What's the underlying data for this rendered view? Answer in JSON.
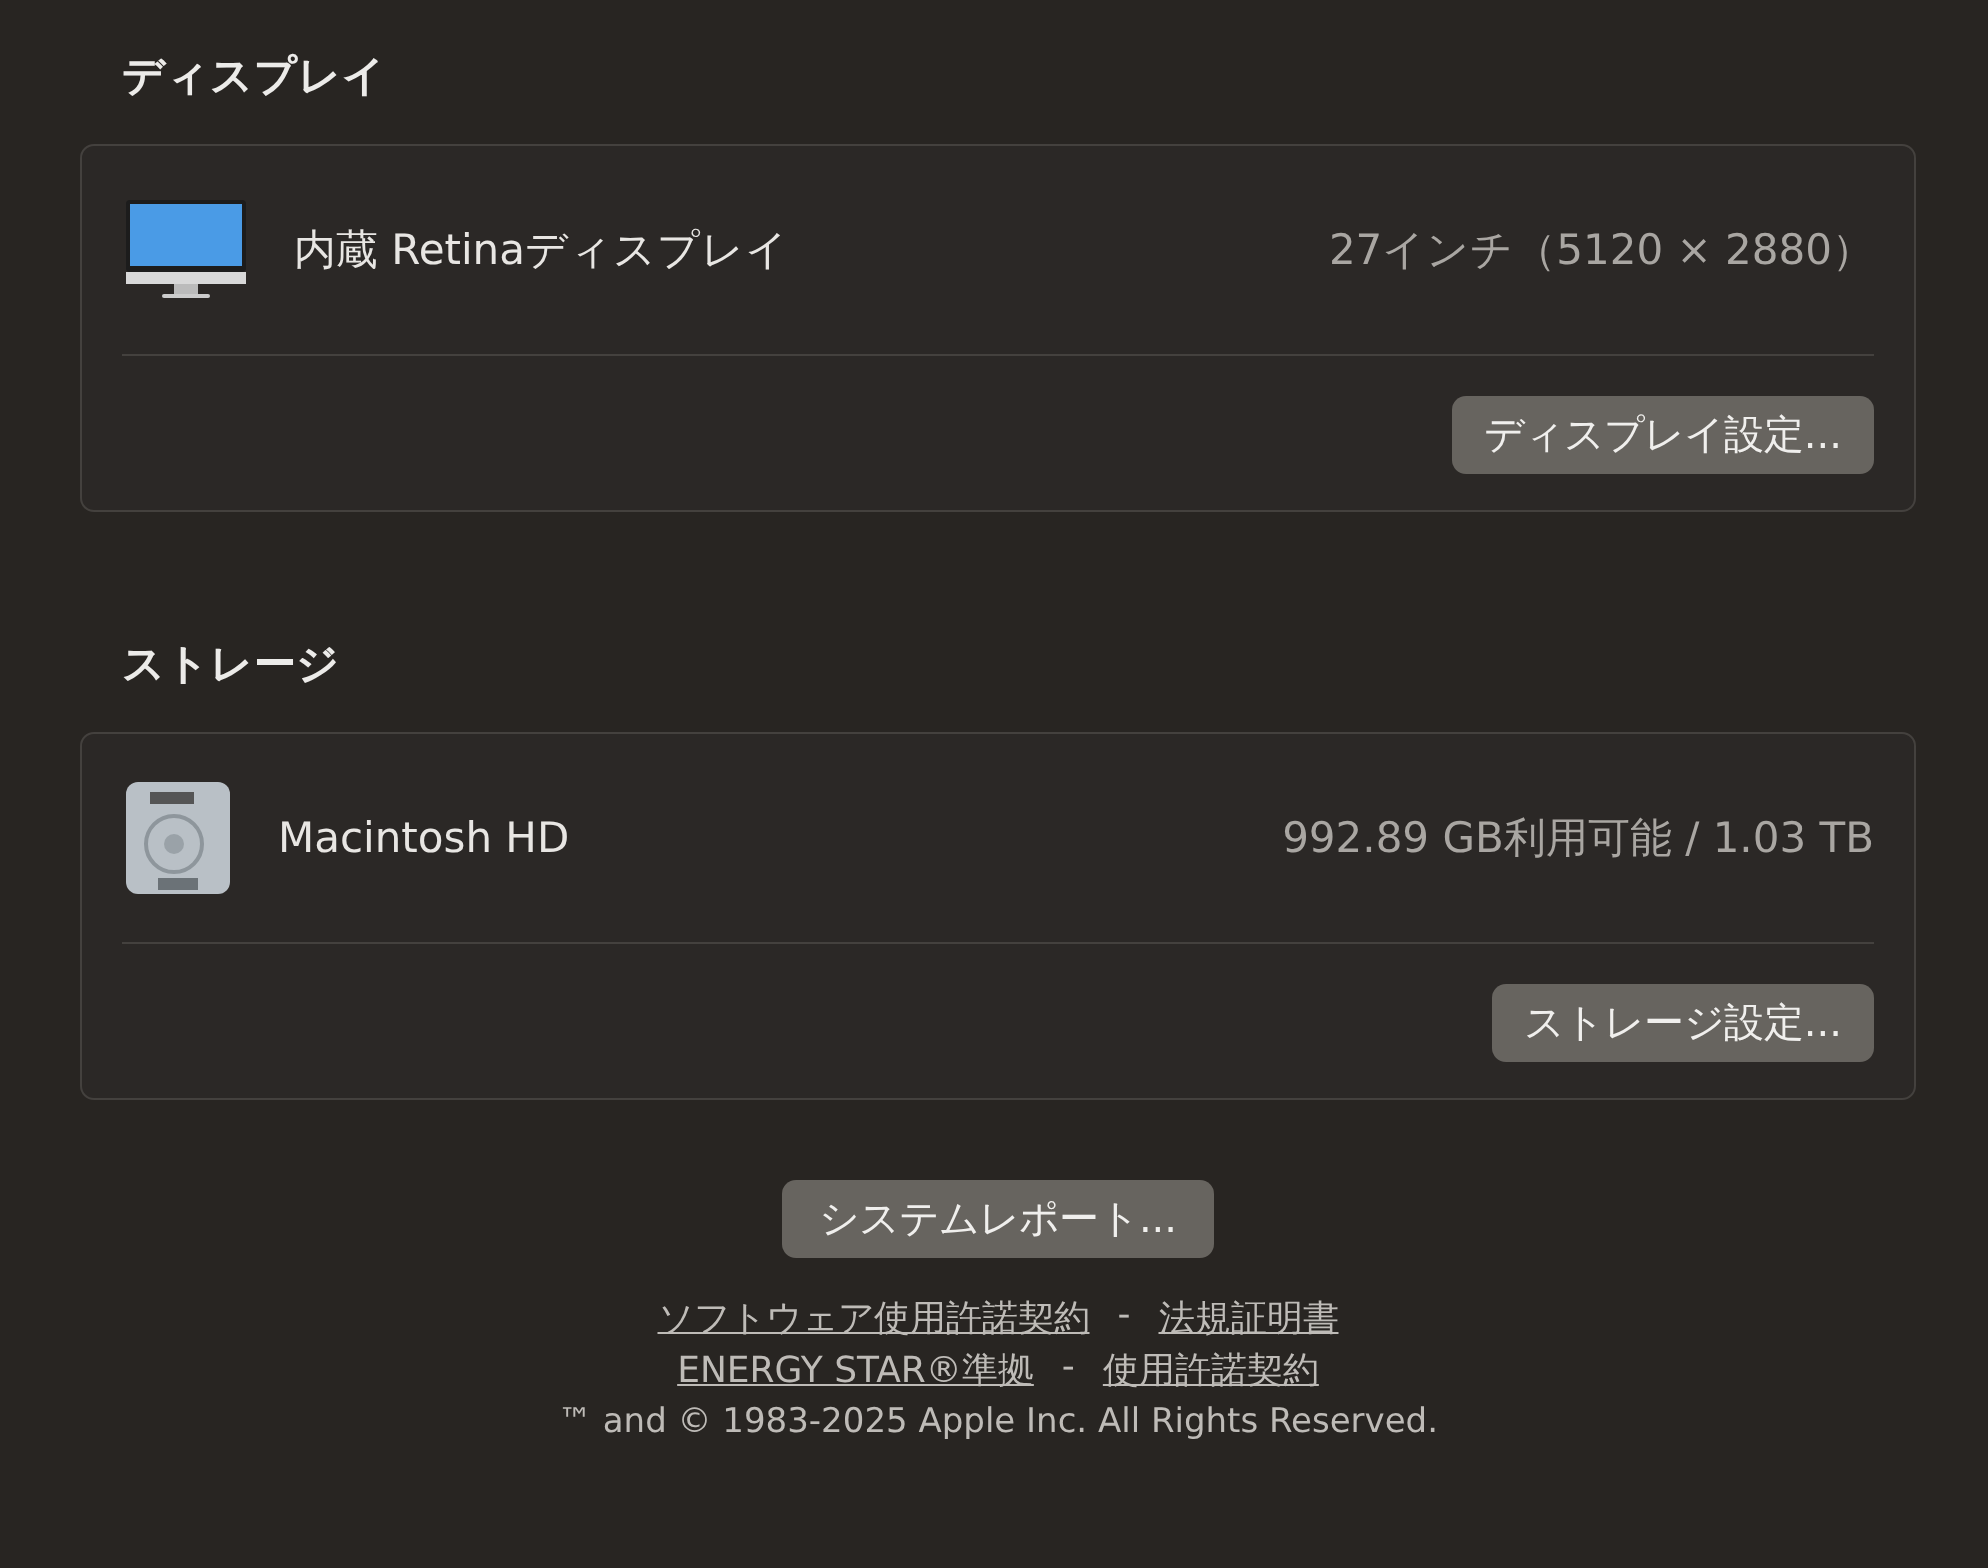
{
  "sections": [
    {
      "title": "ディスプレイ",
      "item": {
        "kind": "display",
        "name": "内蔵 Retinaディスプレイ",
        "detail": "27インチ（5120 × 2880）"
      },
      "button": "ディスプレイ設定..."
    },
    {
      "title": "ストレージ",
      "item": {
        "kind": "disk",
        "name": "Macintosh HD",
        "detail": "992.89 GB利用可能 / 1.03 TB"
      },
      "button": "ストレージ設定..."
    }
  ],
  "report_button": "システムレポート...",
  "link_rows": [
    {
      "links": [
        "ソフトウェア使用許諾契約",
        "法規証明書"
      ],
      "separator": "-"
    },
    {
      "links": [
        "ENERGY STAR®準拠",
        "使用許諾契約"
      ],
      "separator": "-"
    }
  ],
  "copyright": "™ and © 1983-2025 Apple Inc. All Rights Reserved."
}
